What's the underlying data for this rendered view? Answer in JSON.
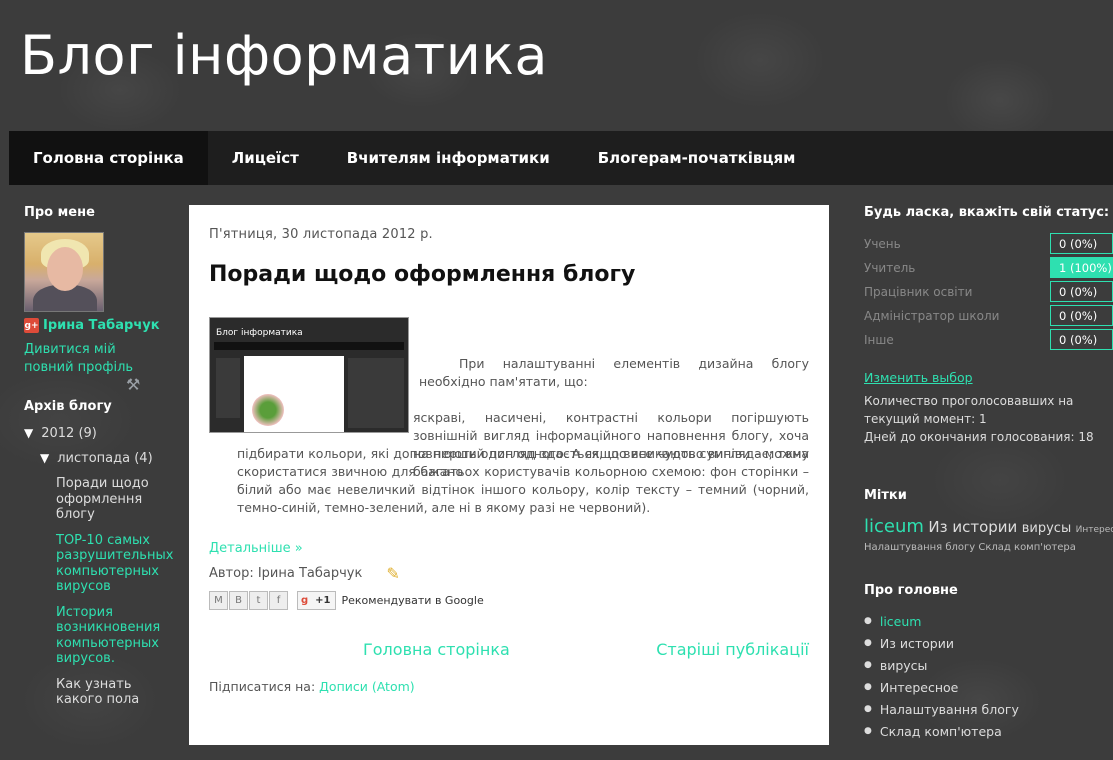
{
  "blog": {
    "title": "Блог інформатика"
  },
  "nav": {
    "tabs": [
      "Головна сторінка",
      "Лицеїст",
      "Вчителям інформатики",
      "Блогерам-початківцям"
    ]
  },
  "about": {
    "heading": "Про мене",
    "name": "Ірина Табарчук",
    "profile_link": "Дивитися мій повний профіль"
  },
  "archive": {
    "heading": "Архів блогу",
    "year": "2012",
    "year_count": "(9)",
    "month": "листопада",
    "month_count": "(4)",
    "posts": [
      "Поради щодо оформлення блогу",
      "TOP-10 самых разрушительных компьютерных вирусов",
      "История возникновения компьютерных вирусов.",
      "Как узнать какого пола"
    ]
  },
  "post": {
    "date": "П'ятниця, 30 листопада 2012 р.",
    "title": "Поради щодо оформлення блогу",
    "image_title": "Блог інформатика",
    "p1": "При налаштуванні елементів дизайна блогу необхідно пам'ятати, що:",
    "p2": "яскраві, насичені, контрастні кольори погіршують зовнішній вигляд інформаційного наповнення блогу, хоча на перший погляд здається, що все чудово виглядає; тому бажано",
    "p3": "підбирати кольори, які доповнюють один одного. А якщо виникають сумніви – можна скористатися звичною для багатьох користувачів кольорною схемою: фон сторінки – білий або має невеличкий відтінок іншого кольору, колір тексту – темний (чорний, темно-синій, темно-зелений, але ні в якому разі не червоний).",
    "more": "Детальніше »",
    "author": "Автор: Ірина Табарчук",
    "share_gplus_count": "+1",
    "recommend": "Рекомендувати в Google"
  },
  "pager": {
    "home": "Головна сторінка",
    "older": "Старіші публікації"
  },
  "subscribe": {
    "label": "Підписатися на:",
    "link": "Дописи (Atom)"
  },
  "poll": {
    "heading": "Будь ласка, вкажіть свій статус:",
    "options": [
      {
        "label": "Учень",
        "value": "0 (0%)"
      },
      {
        "label": "Учитель",
        "value": "1 (100%)"
      },
      {
        "label": "Працівник освіти",
        "value": "0 (0%)"
      },
      {
        "label": "Адміністратор школи",
        "value": "0 (0%)"
      },
      {
        "label": "Інше",
        "value": "0 (0%)"
      }
    ],
    "change": "Изменить выбор",
    "voters": "Количество проголосовавших на текущий момент: 1",
    "days_left": "Дней до окончания голосования: 18"
  },
  "labels": {
    "heading": "Мітки",
    "tag1": "liceum",
    "tag2": "Из истории",
    "tag3": "вирусы",
    "tag4": "Интересное",
    "tag5": "Налаштування блогу",
    "tag6": "Склад комп'ютера"
  },
  "main_topics": {
    "heading": "Про головне",
    "items": [
      "liceum",
      "Из истории",
      "вирусы",
      "Интересное",
      "Налаштування блогу",
      "Склад комп'ютера"
    ]
  },
  "colors": {
    "accent": "#2ee0b0",
    "background": "#3c3c3c",
    "navbar": "#1e1e1e"
  }
}
